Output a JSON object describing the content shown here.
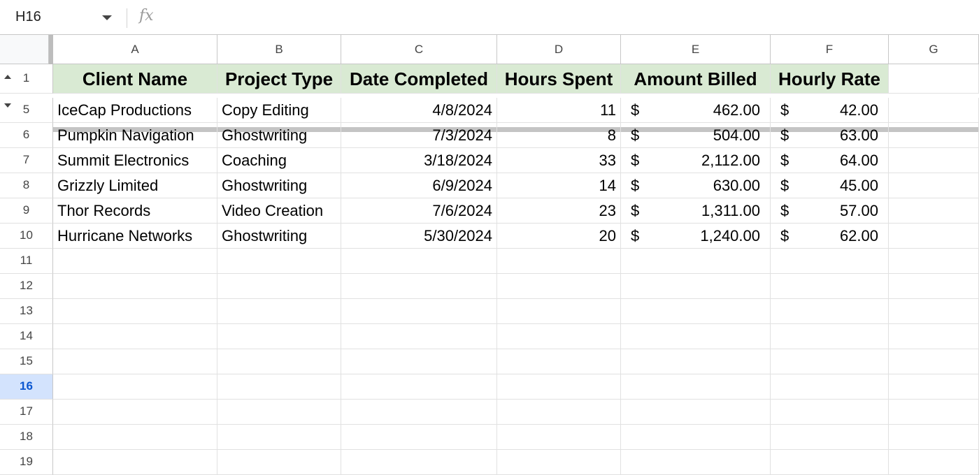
{
  "formula_bar": {
    "name_box": "H16",
    "fx_icon": "fx"
  },
  "columns": [
    "A",
    "B",
    "C",
    "D",
    "E",
    "F",
    "G"
  ],
  "header_row": {
    "row_num": "1",
    "cells": [
      "Client Name",
      "Project Type",
      "Date Completed",
      "Hours Spent",
      "Amount Billed",
      "Hourly Rate"
    ]
  },
  "rows": [
    {
      "num": "5",
      "client": "IceCap Productions",
      "project": "Copy Editing",
      "date": "4/8/2024",
      "hours": "11",
      "billed_cur": "$",
      "billed": "462.00",
      "rate_cur": "$",
      "rate": "42.00"
    },
    {
      "num": "6",
      "client": "Pumpkin Navigation",
      "project": "Ghostwriting",
      "date": "7/3/2024",
      "hours": "8",
      "billed_cur": "$",
      "billed": "504.00",
      "rate_cur": "$",
      "rate": "63.00"
    },
    {
      "num": "7",
      "client": "Summit Electronics",
      "project": "Coaching",
      "date": "3/18/2024",
      "hours": "33",
      "billed_cur": "$",
      "billed": "2,112.00",
      "rate_cur": "$",
      "rate": "64.00"
    },
    {
      "num": "8",
      "client": "Grizzly Limited",
      "project": "Ghostwriting",
      "date": "6/9/2024",
      "hours": "14",
      "billed_cur": "$",
      "billed": "630.00",
      "rate_cur": "$",
      "rate": "45.00"
    },
    {
      "num": "9",
      "client": "Thor Records",
      "project": "Video Creation",
      "date": "7/6/2024",
      "hours": "23",
      "billed_cur": "$",
      "billed": "1,311.00",
      "rate_cur": "$",
      "rate": "57.00"
    },
    {
      "num": "10",
      "client": "Hurricane Networks",
      "project": "Ghostwriting",
      "date": "5/30/2024",
      "hours": "20",
      "billed_cur": "$",
      "billed": "1,240.00",
      "rate_cur": "$",
      "rate": "62.00"
    }
  ],
  "empty_rows": [
    "11",
    "12",
    "13",
    "14",
    "15",
    "16",
    "17",
    "18",
    "19"
  ],
  "selected_row": "16",
  "colors": {
    "header_fill": "#d9ead3",
    "selected_row_fill": "#d3e3fd",
    "selected_row_text": "#0b57d0"
  }
}
